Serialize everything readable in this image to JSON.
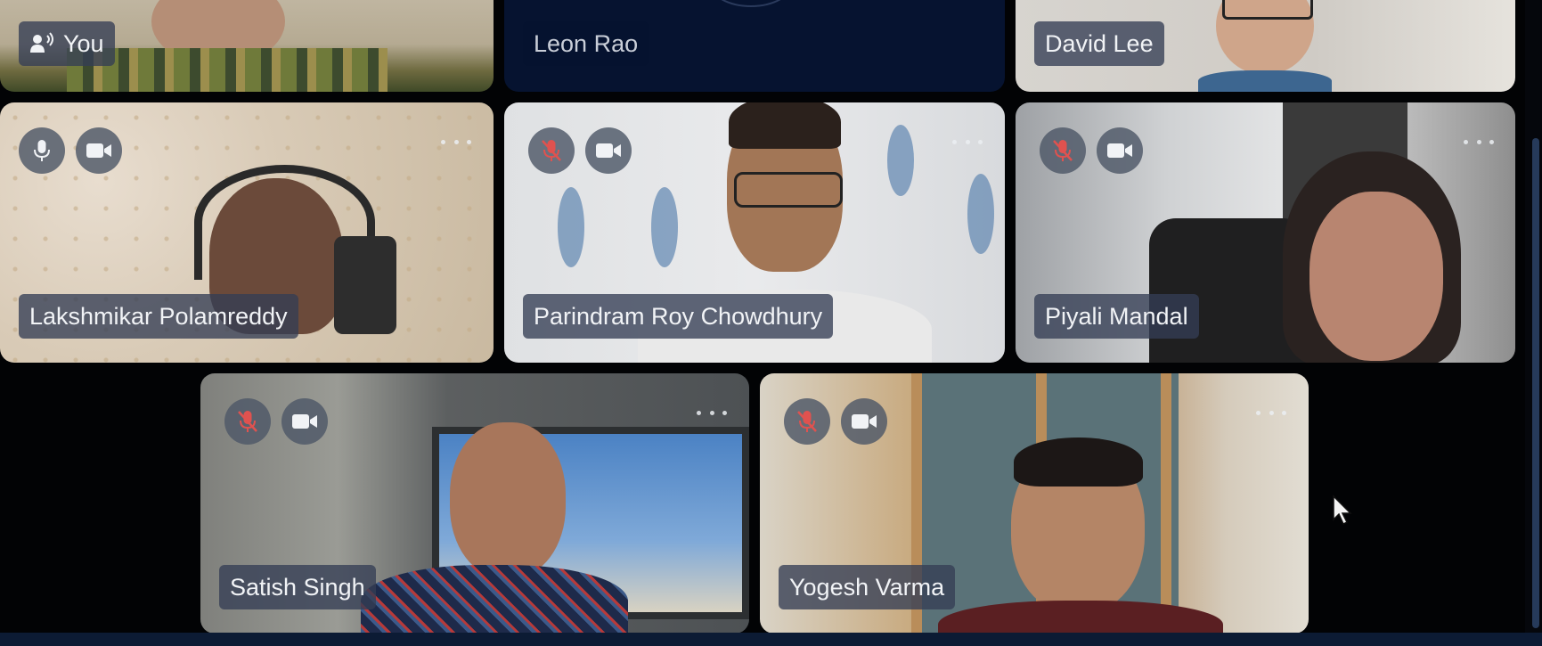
{
  "meeting": {
    "participants": [
      {
        "name": "You",
        "speaker_icon": "speaking-person-icon",
        "controls": false
      },
      {
        "name": "Leon Rao",
        "controls": false
      },
      {
        "name": "David Lee",
        "controls": false
      },
      {
        "name": "Lakshmikar Polamreddy",
        "mic": "on",
        "camera": "on",
        "controls": true
      },
      {
        "name": "Parindram Roy Chowdhury",
        "mic": "muted",
        "camera": "on",
        "controls": true
      },
      {
        "name": "Piyali Mandal",
        "mic": "muted",
        "camera": "on",
        "controls": true
      },
      {
        "name": "Satish Singh",
        "mic": "muted",
        "camera": "on",
        "controls": true
      },
      {
        "name": "Yogesh Varma",
        "mic": "muted",
        "camera": "on",
        "controls": true
      }
    ]
  },
  "colors": {
    "background": "#020305",
    "name_tag_bg": "#343e54",
    "control_bg": "#4e5868",
    "muted_icon": "#e0524f",
    "icon_white": "#f1f3f6",
    "tile_dark": "#061330",
    "bottom_bar": "#0c1b34"
  },
  "icons": {
    "mic": "microphone-icon",
    "mic_muted": "microphone-muted-icon",
    "camera": "video-camera-icon",
    "more": "more-options-icon",
    "cursor": "mouse-pointer-icon"
  }
}
